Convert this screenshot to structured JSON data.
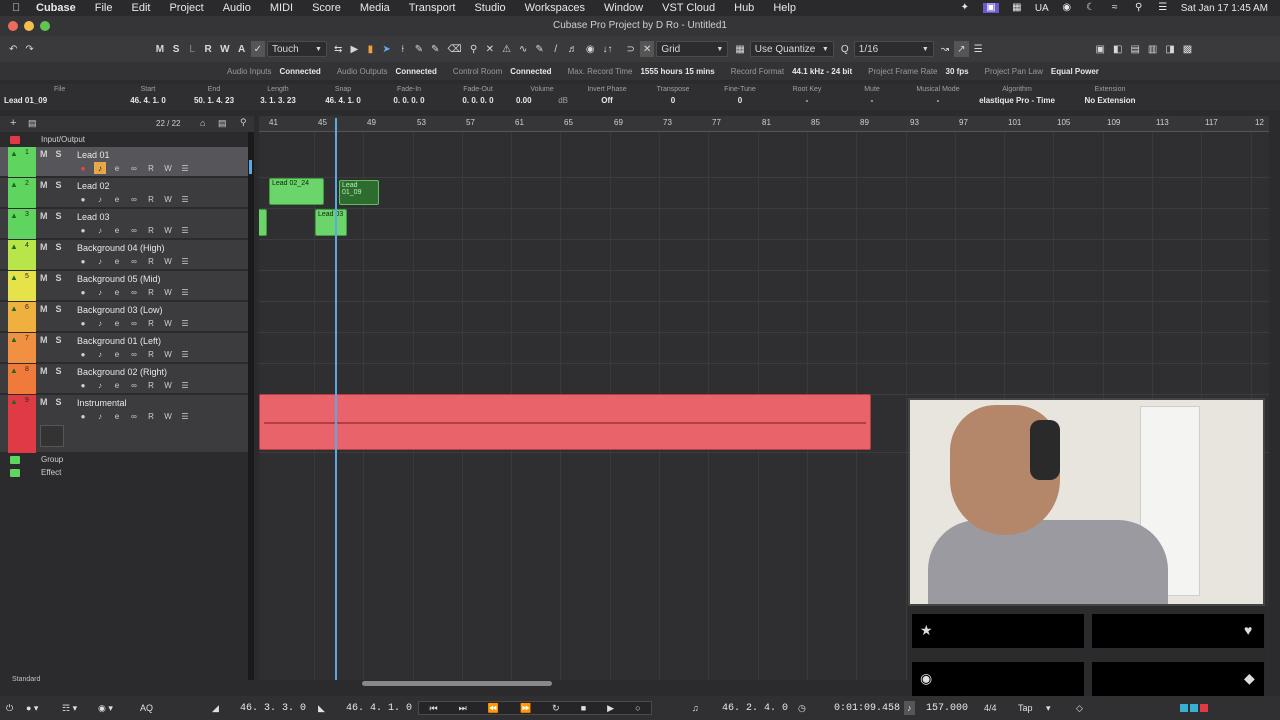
{
  "menubar": {
    "app": "Cubase",
    "items": [
      "File",
      "Edit",
      "Project",
      "Audio",
      "MIDI",
      "Score",
      "Media",
      "Transport",
      "Studio",
      "Workspaces",
      "Window",
      "VST Cloud",
      "Hub",
      "Help"
    ],
    "lang": "UA",
    "datetime": "Sat Jan 17  1:45 AM"
  },
  "window": {
    "title": "Cubase Pro Project by D Ro - Untitled1"
  },
  "toolbar": {
    "ms_buttons": [
      "M",
      "S",
      "L",
      "R",
      "W",
      "A"
    ],
    "automation_mode": "Touch",
    "snap_type": "Grid",
    "quantize_mode": "Use Quantize",
    "quantize_value": "1/16"
  },
  "status": {
    "audio_inputs_label": "Audio Inputs",
    "audio_inputs_value": "Connected",
    "audio_outputs_label": "Audio Outputs",
    "audio_outputs_value": "Connected",
    "control_room_label": "Control Room",
    "control_room_value": "Connected",
    "max_record_label": "Max. Record Time",
    "max_record_value": "1555 hours 15 mins",
    "record_format_label": "Record Format",
    "record_format_value": "44.1 kHz - 24 bit",
    "frame_rate_label": "Project Frame Rate",
    "frame_rate_value": "30 fps",
    "pan_law_label": "Project Pan Law",
    "pan_law_value": "Equal Power"
  },
  "info": {
    "file": {
      "h": "File",
      "v": "Lead 01_09"
    },
    "start": {
      "h": "Start",
      "v": "46. 4. 1.   0"
    },
    "end": {
      "h": "End",
      "v": "50. 1. 4. 23"
    },
    "length": {
      "h": "Length",
      "v": "3. 1. 3. 23"
    },
    "snap": {
      "h": "Snap",
      "v": "46. 4. 1.   0"
    },
    "fade_in": {
      "h": "Fade-In",
      "v": "0. 0. 0.   0"
    },
    "fade_out": {
      "h": "Fade-Out",
      "v": "0. 0. 0.   0"
    },
    "volume": {
      "h": "Volume",
      "v": "0.00",
      "unit": "dB"
    },
    "invert_phase": {
      "h": "Invert Phase",
      "v": "Off"
    },
    "transpose": {
      "h": "Transpose",
      "v": "0"
    },
    "fine_tune": {
      "h": "Fine-Tune",
      "v": "0"
    },
    "root_key": {
      "h": "Root Key",
      "v": "-"
    },
    "mute": {
      "h": "Mute",
      "v": "-"
    },
    "musical_mode": {
      "h": "Musical Mode",
      "v": "-"
    },
    "algorithm": {
      "h": "Algorithm",
      "v": "elastique Pro - Time"
    },
    "extension": {
      "h": "Extension",
      "v": "No Extension"
    }
  },
  "tracklist": {
    "count": "22 / 22",
    "input_output": "Input/Output",
    "group": "Group",
    "effect": "Effect",
    "tracks": [
      {
        "num": "1",
        "name": "Lead 01",
        "color": "#5fd45f"
      },
      {
        "num": "2",
        "name": "Lead 02",
        "color": "#5fd45f"
      },
      {
        "num": "3",
        "name": "Lead 03",
        "color": "#5fd45f"
      },
      {
        "num": "4",
        "name": "Background 04 (High)",
        "color": "#b8e64a"
      },
      {
        "num": "5",
        "name": "Background 05 (Mid)",
        "color": "#e6e24a"
      },
      {
        "num": "6",
        "name": "Background 03 (Low)",
        "color": "#f0b040"
      },
      {
        "num": "7",
        "name": "Background 01 (Left)",
        "color": "#f09040"
      },
      {
        "num": "8",
        "name": "Background 02 (Right)",
        "color": "#f07a3a"
      },
      {
        "num": "9",
        "name": "Instrumental",
        "color": "#e03a44"
      }
    ],
    "ms": {
      "m": "M",
      "s": "S"
    },
    "ctrl_r": "R",
    "ctrl_w": "W"
  },
  "ruler": {
    "bars": [
      "41",
      "45",
      "49",
      "53",
      "57",
      "61",
      "65",
      "69",
      "73",
      "77",
      "81",
      "85",
      "89",
      "93",
      "97",
      "101",
      "105",
      "109",
      "113",
      "117",
      "12"
    ]
  },
  "clips": {
    "lead02": "Lead 02_24",
    "lead01": "Lead 01_09",
    "lead03": "Lead 03"
  },
  "footer": {
    "label": "Standard"
  },
  "transport": {
    "left_locator": "46. 3. 3.   0",
    "right_locator": "46. 4. 1.   0",
    "position": "46. 2. 4.   0",
    "time": "0:01:09.458",
    "tempo": "157.000",
    "signature": "4/4",
    "tap": "Tap",
    "aq": "AQ"
  },
  "colors": {
    "accent_blue": "#5aa9e6",
    "clip_green": "#6bd46b",
    "clip_red": "#e9646a"
  }
}
